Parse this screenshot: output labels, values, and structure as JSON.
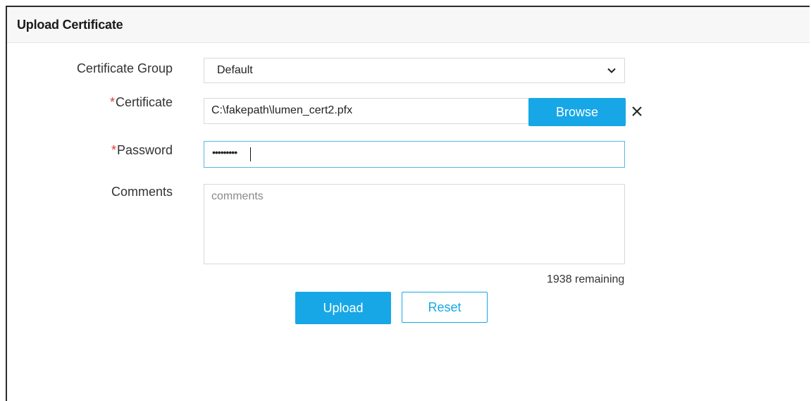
{
  "header": {
    "title": "Upload Certificate"
  },
  "form": {
    "certificate_group": {
      "label": "Certificate Group",
      "selected": "Default"
    },
    "certificate": {
      "required_mark": "*",
      "label": "Certificate",
      "value": "C:\\fakepath\\lumen_cert2.pfx",
      "browse_label": "Browse"
    },
    "password": {
      "required_mark": "*",
      "label": "Password",
      "masked_value": "•••••••••"
    },
    "comments": {
      "label": "Comments",
      "placeholder": "comments",
      "remaining_text": "1938 remaining"
    }
  },
  "actions": {
    "upload_label": "Upload",
    "reset_label": "Reset"
  },
  "colors": {
    "accent": "#17a7e6",
    "required": "#e53935",
    "focus_border": "#58b7e0"
  },
  "icons": {
    "select_chevron": "chevron-down-icon",
    "clear_file": "close-icon"
  }
}
